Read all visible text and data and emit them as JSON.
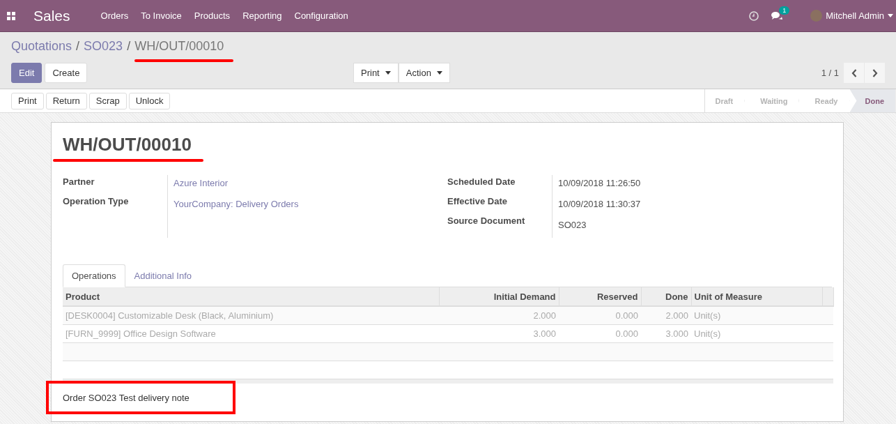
{
  "navbar": {
    "app_name": "Sales",
    "menu": [
      "Orders",
      "To Invoice",
      "Products",
      "Reporting",
      "Configuration"
    ],
    "message_count": "1",
    "user": "Mitchell Admin"
  },
  "breadcrumbs": [
    {
      "label": "Quotations",
      "current": false
    },
    {
      "label": "SO023",
      "current": false
    },
    {
      "label": "WH/OUT/00010",
      "current": true
    }
  ],
  "breadcrumb_separator": "/",
  "buttons": [
    {
      "label": "Edit",
      "kind": "primary"
    },
    {
      "label": "Create",
      "kind": "secondary"
    }
  ],
  "dropdowns": [
    "Print",
    "Action"
  ],
  "pager": "1 / 1",
  "header_buttons": [
    "Print",
    "Return",
    "Scrap",
    "Unlock"
  ],
  "stages": [
    {
      "label": "Draft",
      "selected": false
    },
    {
      "label": "Waiting",
      "selected": false
    },
    {
      "label": "Ready",
      "selected": false
    },
    {
      "label": "Done",
      "selected": true
    }
  ],
  "record": {
    "title": "WH/OUT/00010",
    "left_fields": [
      {
        "label": "Partner",
        "value": "Azure Interior",
        "kind": "link"
      },
      {
        "label": "Operation Type",
        "value": "YourCompany: Delivery Orders",
        "kind": "link"
      }
    ],
    "right_fields": [
      {
        "label": "Scheduled Date",
        "value": "10/09/2018 11:26:50"
      },
      {
        "label": "Effective Date",
        "value": "10/09/2018 11:30:37"
      },
      {
        "label": "Source Document",
        "value": "SO023"
      }
    ]
  },
  "tabs": [
    {
      "label": "Operations",
      "selected": true
    },
    {
      "label": "Additional Info",
      "selected": false
    }
  ],
  "table": {
    "columns": [
      "Product",
      "Initial Demand",
      "Reserved",
      "Done",
      "Unit of Measure"
    ],
    "rows": [
      [
        "[DESK0004] Customizable Desk (Black, Aluminium)",
        "2.000",
        "0.000",
        "2.000",
        "Unit(s)"
      ],
      [
        "[FURN_9999] Office Design Software",
        "3.000",
        "0.000",
        "3.000",
        "Unit(s)"
      ]
    ]
  },
  "note": "Order SO023 Test delivery note"
}
